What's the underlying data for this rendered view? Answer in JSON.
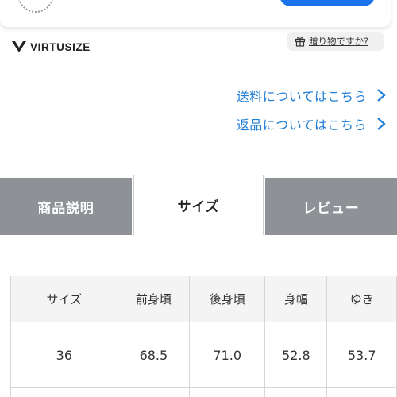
{
  "brand": {
    "name": "VIRTUSIZE"
  },
  "gift": {
    "label": "贈り物ですか?"
  },
  "links": [
    {
      "label": "送料についてはこちら"
    },
    {
      "label": "返品についてはこちら"
    }
  ],
  "tabs": [
    {
      "label": "商品説明",
      "active": false
    },
    {
      "label": "サイズ",
      "active": true
    },
    {
      "label": "レビュー",
      "active": false
    }
  ],
  "size_table": {
    "headers": [
      "サイズ",
      "前身頃",
      "後身頃",
      "身幅",
      "ゆき"
    ],
    "rows": [
      [
        "36",
        "68.5",
        "71.0",
        "52.8",
        "53.7"
      ]
    ]
  },
  "colors": {
    "link": "#1f7ed6",
    "tab_inactive": "#8e9196",
    "primary_button": "#1a73e8"
  }
}
